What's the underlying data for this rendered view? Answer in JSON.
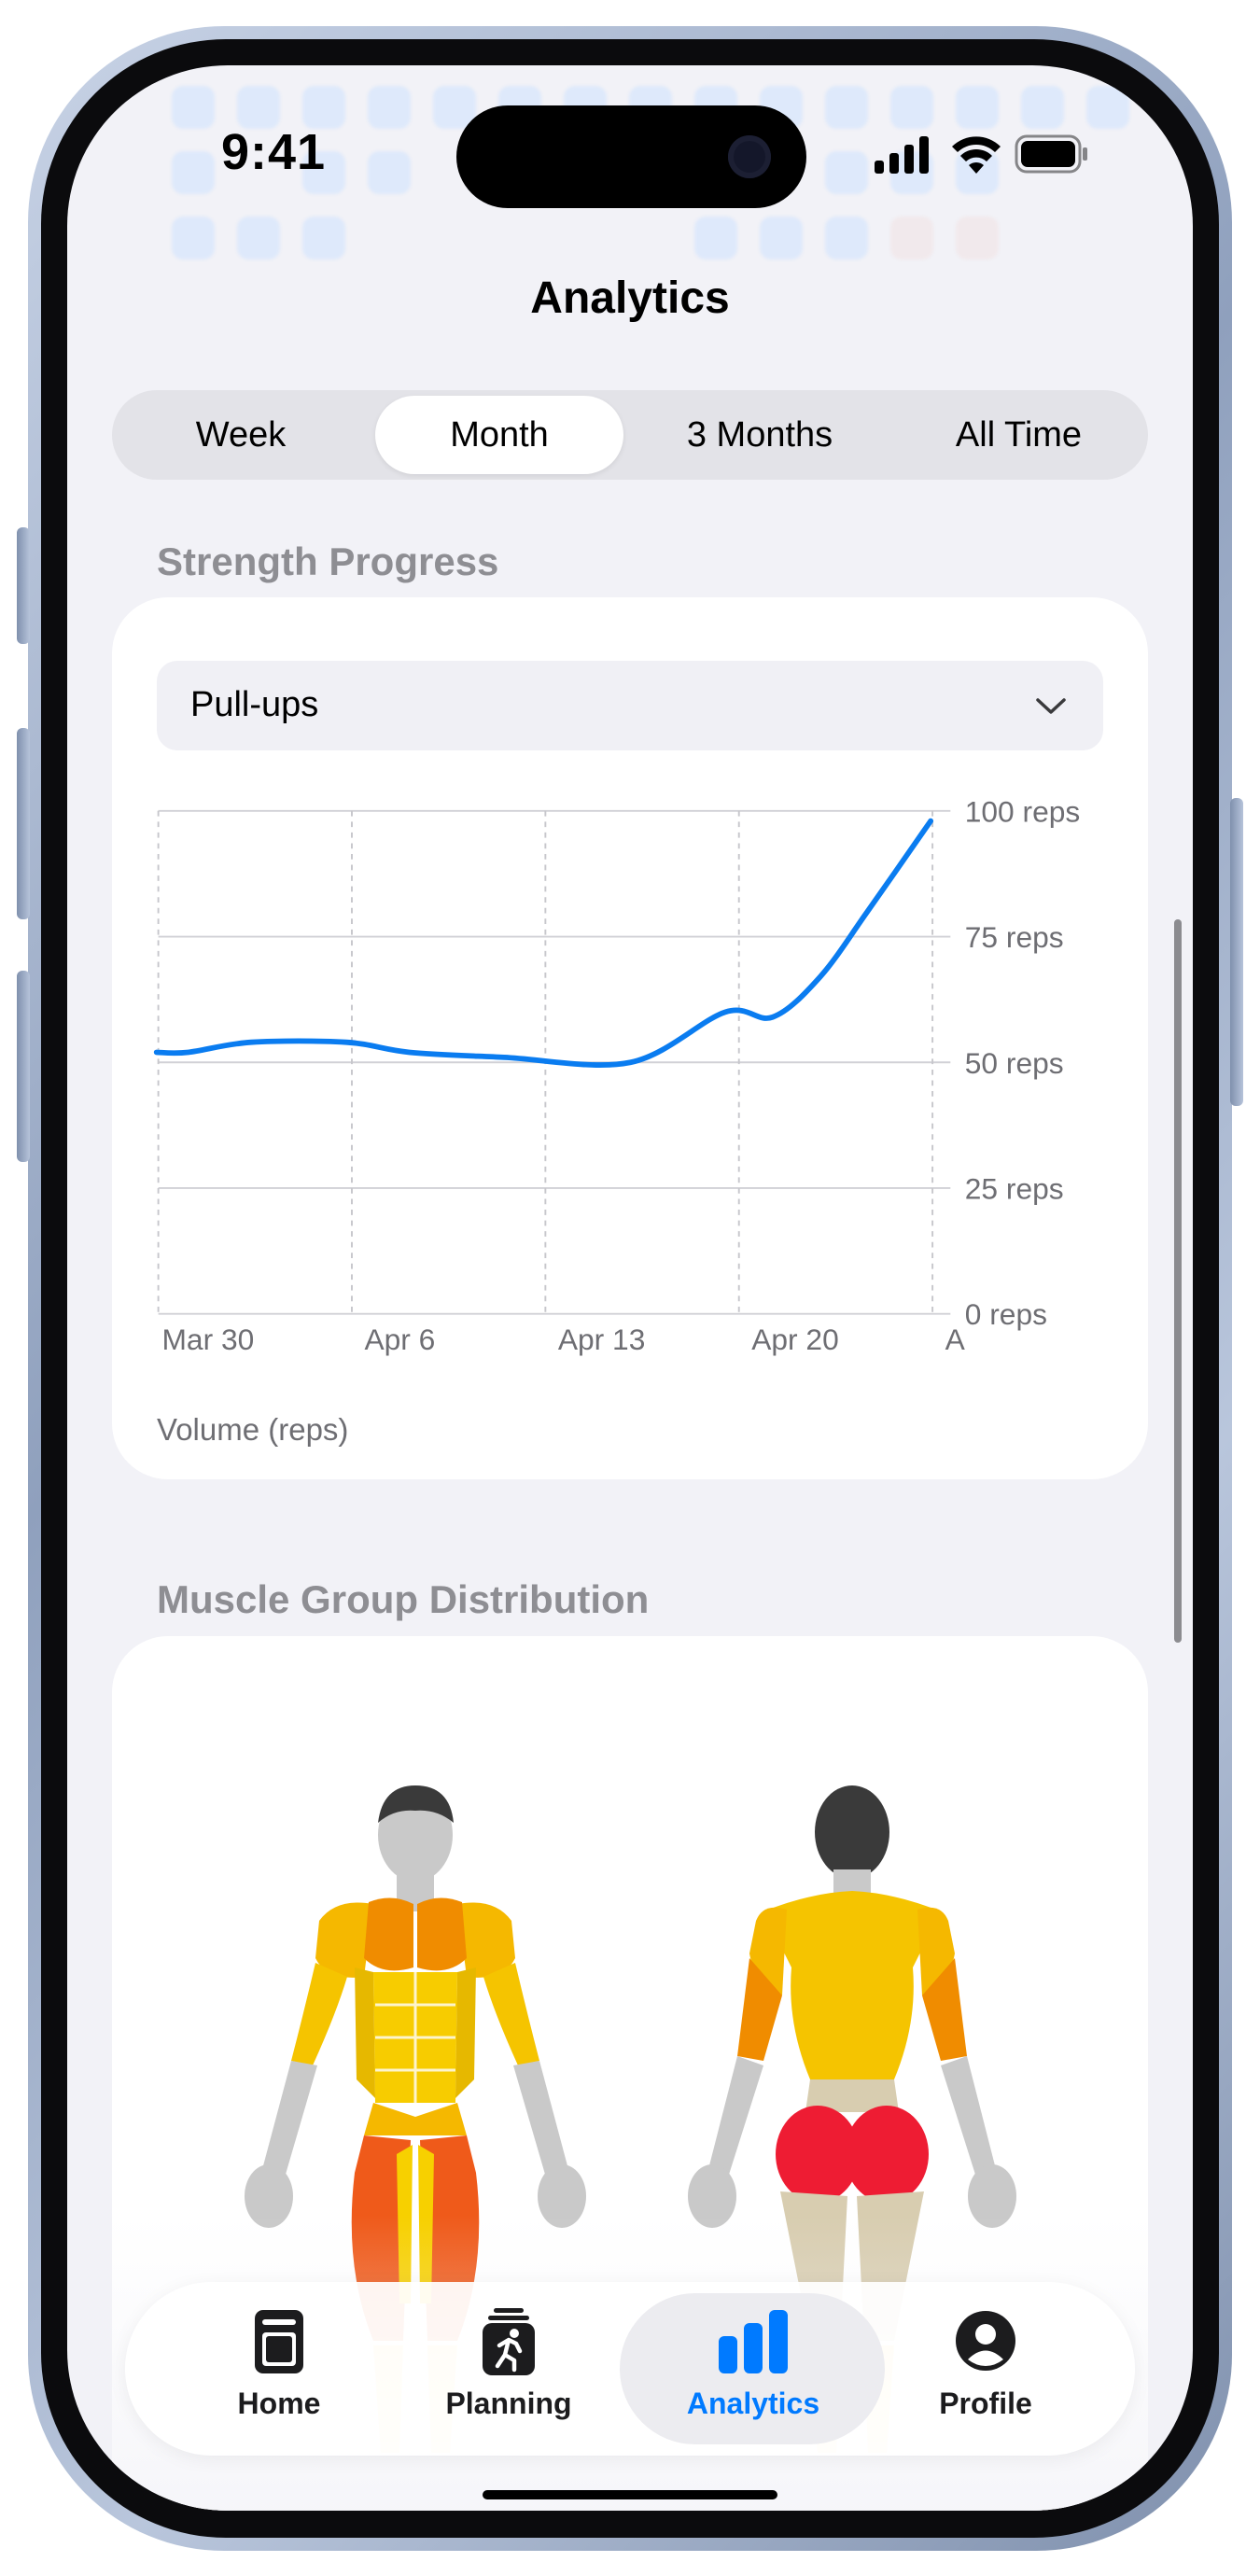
{
  "status_bar": {
    "time": "9:41"
  },
  "header": {
    "title": "Analytics"
  },
  "segmented": {
    "options": [
      "Week",
      "Month",
      "3 Months",
      "All Time"
    ],
    "selected": "Month"
  },
  "strength": {
    "heading": "Strength Progress",
    "exercise": "Pull-ups",
    "footer": "Volume (reps)"
  },
  "chart_data": {
    "type": "line",
    "x_tick_labels": [
      "Mar 30",
      "Apr 6",
      "Apr 13",
      "Apr 20",
      "A"
    ],
    "y_tick_labels": [
      "100 reps",
      "75 reps",
      "50 reps",
      "25 reps",
      "0 reps"
    ],
    "ylim": [
      0,
      100
    ],
    "grid": true,
    "series": [
      {
        "color": "#0a7cf0",
        "x_days": [
          0,
          1,
          3,
          6,
          8,
          11,
          15,
          18,
          19.5,
          21,
          22.5,
          24.5
        ],
        "values": [
          52,
          52,
          54,
          54,
          52,
          51,
          50,
          60,
          59,
          67,
          80,
          98
        ]
      }
    ]
  },
  "muscle": {
    "heading": "Muscle Group Distribution"
  },
  "tabs": [
    {
      "label": "Home",
      "icon": "book-icon",
      "active": false
    },
    {
      "label": "Planning",
      "icon": "person-running-icon",
      "active": false
    },
    {
      "label": "Analytics",
      "icon": "bar-chart-icon",
      "active": true
    },
    {
      "label": "Profile",
      "icon": "person-circle-icon",
      "active": false
    }
  ],
  "colors": {
    "accent": "#007aff",
    "line": "#0a7cf0",
    "background": "#f2f2f7"
  }
}
